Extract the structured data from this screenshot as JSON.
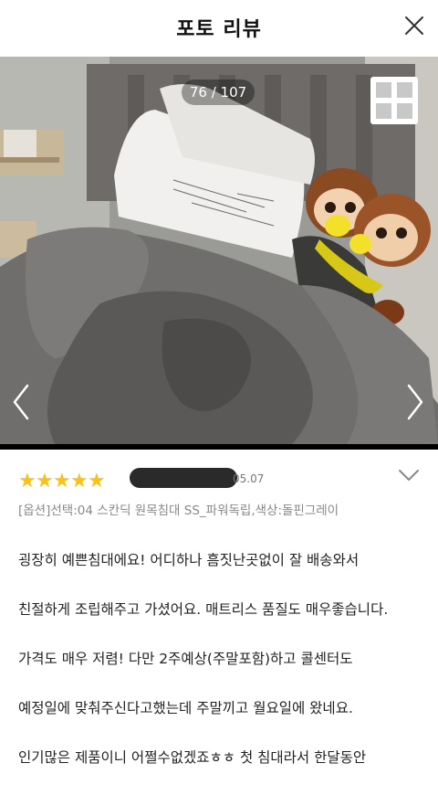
{
  "header": {
    "title": "포토 리뷰",
    "close_icon": "close-icon"
  },
  "photo": {
    "counter": "76 / 107",
    "grid_icon": "grid-icon",
    "prev_icon": "chevron-left-icon",
    "next_icon": "chevron-right-icon"
  },
  "review": {
    "rating": 5,
    "star_glyph": "★",
    "date": "05.07",
    "option": "[옵션]선택:04 스칸딕 원목침대 SS_파워독립,색상:돌핀그레이",
    "lines": [
      "굉장히 예쁜침대에요! 어디하나 흠짓난곳없이 잘 배송와서",
      "친절하게 조립해주고 가셨어요. 매트리스 품질도 매우좋습니다.",
      "가격도 매우 저렴! 다만 2주예상(주말포함)하고 콜센터도",
      "예정일에 맞춰주신다고했는데 주말끼고 월요일에 왔네요.",
      "인기많은 제품이니 어쩔수없겠죠ㅎㅎ 첫 침대라서 한달동안"
    ],
    "expand_icon": "chevron-down-icon"
  },
  "colors": {
    "star": "#f7c21a",
    "text": "#222222",
    "muted": "#888888"
  }
}
